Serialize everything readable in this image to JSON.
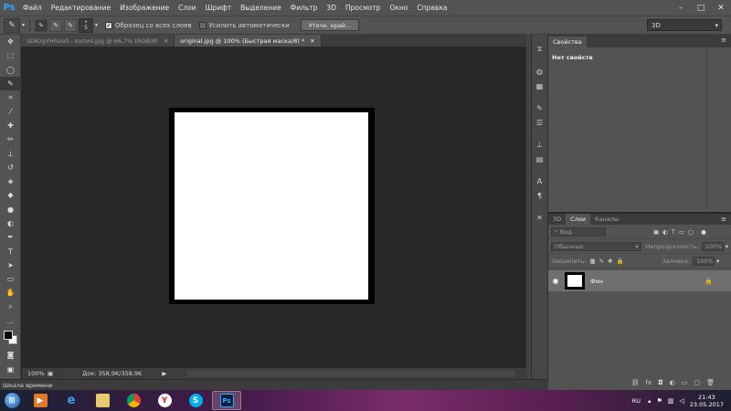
{
  "app": {
    "logo": "Ps",
    "menu": [
      "Файл",
      "Редактирование",
      "Изображение",
      "Слои",
      "Шрифт",
      "Выделение",
      "Фильтр",
      "3D",
      "Просмотр",
      "Окно",
      "Справка"
    ],
    "window_controls": [
      "–",
      "□",
      "✕"
    ]
  },
  "options": {
    "brush_size": "5",
    "sample_all_layers": "Образец со всех слоев",
    "sample_all_checked": true,
    "auto_enhance": "Усилить автоматически",
    "auto_enhance_checked": false,
    "refine_edge": "Уточн. край...",
    "workspace": "3D"
  },
  "tabs": [
    {
      "label": "SDKzgYHhUs0 - копия.jpg @ 66,7% (RGB/8)",
      "active": false
    },
    {
      "label": "original.jpg @ 100% (Быстрая маска/8) *",
      "active": true
    }
  ],
  "status": {
    "zoom": "100%",
    "doc_size": "Док: 358,9K/358,9K",
    "timeline": "Шкала времени"
  },
  "properties": {
    "tab": "Свойства",
    "empty": "Нет свойств"
  },
  "layers": {
    "tabs": [
      "3D",
      "Слои",
      "Каналы"
    ],
    "active_tab": "Слои",
    "filter": "Вид",
    "blend_mode": "Обычные",
    "opacity_label": "Непрозрачность:",
    "opacity_value": "100%",
    "lock_label": "Закрепить:",
    "fill_label": "Заливка:",
    "fill_value": "100%",
    "layer_name": "Фон"
  },
  "taskbar": {
    "language": "RU",
    "time": "21:43",
    "date": "23.05.2017"
  },
  "colors": {
    "foreground": "#000000",
    "background": "#ffffff",
    "ps_blue": "#31a8ff"
  }
}
